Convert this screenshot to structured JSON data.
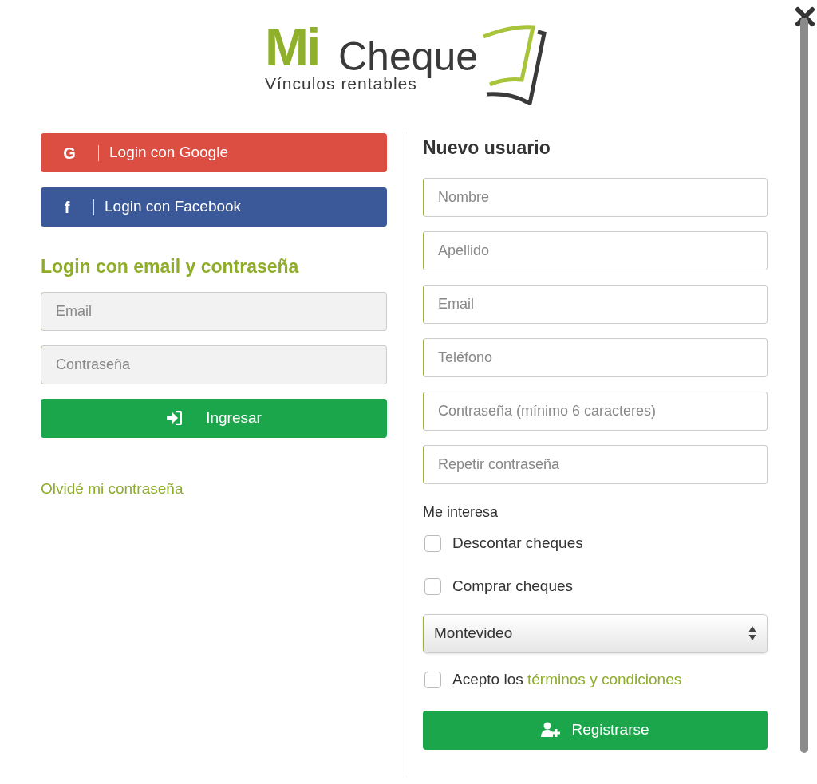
{
  "logo": {
    "mark": "Mi",
    "name": "Cheque",
    "tagline": "Vínculos rentables"
  },
  "social_buttons": [
    {
      "kind": "google",
      "icon_glyph": "G",
      "label": "Login con Google"
    },
    {
      "kind": "facebook",
      "icon_glyph": "f",
      "label": "Login con Facebook"
    }
  ],
  "login": {
    "title": "Login con email y contraseña",
    "fields": [
      {
        "placeholder": "Email"
      },
      {
        "placeholder": "Contraseña"
      }
    ],
    "submit": "Ingresar",
    "forgot_link": "Olvidé mi contraseña"
  },
  "register": {
    "title": "Nuevo usuario",
    "fields": [
      {
        "placeholder": "Nombre"
      },
      {
        "placeholder": "Apellido"
      },
      {
        "placeholder": "Email"
      },
      {
        "placeholder": "Teléfono"
      },
      {
        "placeholder": "Contraseña (mínimo 6 caracteres)"
      },
      {
        "placeholder": "Repetir contraseña"
      }
    ],
    "interests_label": "Me interesa",
    "interests": [
      {
        "label": "Descontar cheques",
        "checked": false
      },
      {
        "label": "Comprar cheques",
        "checked": false
      }
    ],
    "city_select": {
      "value": "Montevideo"
    },
    "terms": {
      "text": "Acepto los",
      "link": "términos y condiciones",
      "checked": false
    },
    "submit": "Registrarse"
  }
}
